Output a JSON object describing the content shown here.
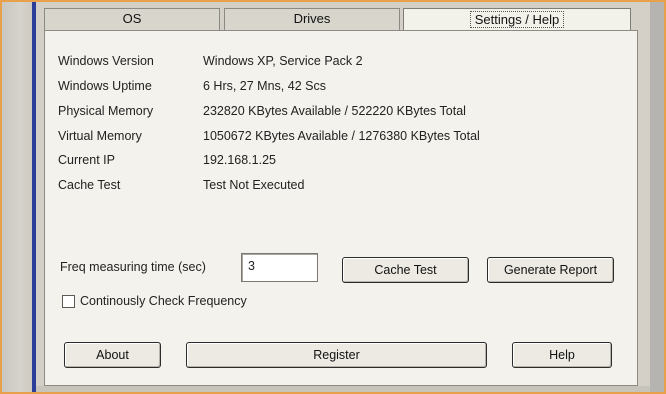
{
  "tabs": [
    {
      "label": "OS"
    },
    {
      "label": "Drives"
    },
    {
      "label": "Settings / Help",
      "active": true
    }
  ],
  "info": {
    "windows_version": {
      "label": "Windows Version",
      "value": "Windows XP, Service Pack 2"
    },
    "windows_uptime": {
      "label": "Windows Uptime",
      "value": "6 Hrs, 27 Mns, 42 Scs"
    },
    "physical_memory": {
      "label": "Physical Memory",
      "value": "232820 KBytes Available / 522220 KBytes Total"
    },
    "virtual_memory": {
      "label": "Virtual Memory",
      "value": "1050672 KBytes Available / 1276380 KBytes Total"
    },
    "current_ip": {
      "label": "Current IP",
      "value": "192.168.1.25"
    },
    "cache_test": {
      "label": "Cache Test",
      "value": "Test Not Executed"
    }
  },
  "freq": {
    "label": "Freq measuring time (sec)",
    "value": "3"
  },
  "buttons": {
    "cache_test": "Cache Test",
    "generate_report": "Generate Report",
    "about": "About",
    "register": "Register",
    "help": "Help"
  },
  "checkbox": {
    "label": "Continously Check Frequency",
    "checked": false
  },
  "colors": {
    "frame_accent": "#e8a04a",
    "side_bar": "#2b3f9a",
    "panel_bg": "#f3f2ec"
  }
}
